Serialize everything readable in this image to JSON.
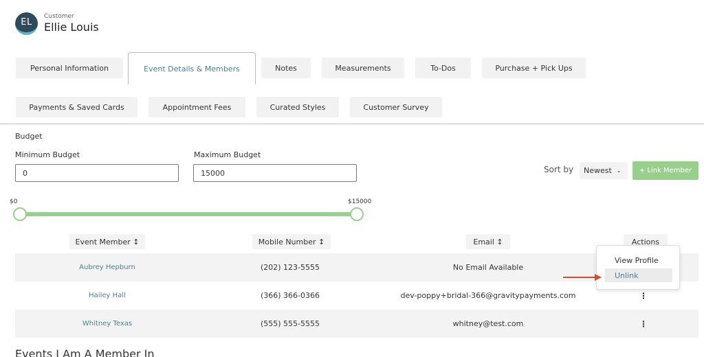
{
  "customer": {
    "initials": "EL",
    "role": "Customer",
    "name": "Ellie Louis"
  },
  "tabs": [
    {
      "label": "Personal Information"
    },
    {
      "label": "Event Details & Members"
    },
    {
      "label": "Notes"
    },
    {
      "label": "Measurements"
    },
    {
      "label": "To-Dos"
    },
    {
      "label": "Purchase + Pick Ups"
    },
    {
      "label": "Payments & Saved Cards"
    },
    {
      "label": "Appointment Fees"
    },
    {
      "label": "Curated Styles"
    },
    {
      "label": "Customer Survey"
    }
  ],
  "active_tab": "Event Details & Members",
  "budget": {
    "heading": "Budget",
    "min_label": "Minimum Budget",
    "min_value": "0",
    "max_label": "Maximum Budget",
    "max_value": "15000",
    "range_min_label": "$0",
    "range_max_label": "$15000"
  },
  "sort": {
    "label": "Sort by",
    "selected": "Newest"
  },
  "link_member_label": "+ Link Member",
  "table": {
    "headers": [
      "Event Member ↕",
      "Mobile Number ↕",
      "Email ↕",
      "Actions"
    ],
    "rows": [
      {
        "member": "Aubrey Hepburn",
        "mobile": "(202) 123-5555",
        "email": "No Email Available",
        "action": ""
      },
      {
        "member": "Hailey Hall",
        "mobile": "(366) 366-0366",
        "email": "dev-poppy+bridal-366@gravitypayments.com",
        "action": "⋮"
      },
      {
        "member": "Whitney Texas",
        "mobile": "(555) 555-5555",
        "email": "whitney@test.com",
        "action": "⋮"
      }
    ]
  },
  "actions_menu": {
    "items": [
      "View Profile",
      "Unlink"
    ]
  },
  "events_section_title": "Events I Am A Member In",
  "colors": {
    "accent": "#4a7f93",
    "green": "#99cf8c",
    "arrow": "#e04a2b"
  }
}
